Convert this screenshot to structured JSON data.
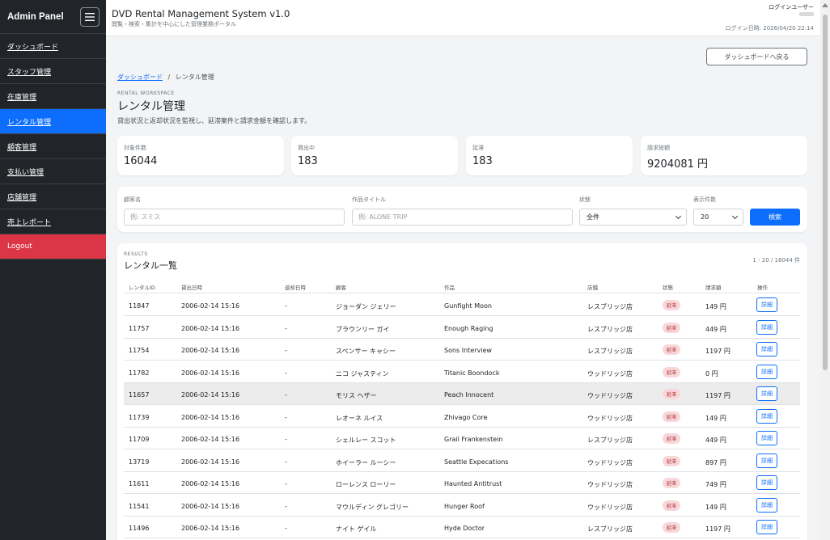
{
  "sidebar": {
    "title": "Admin Panel",
    "items": [
      {
        "label": "ダッシュボード"
      },
      {
        "label": "スタッフ管理"
      },
      {
        "label": "在庫管理"
      },
      {
        "label": "レンタル管理"
      },
      {
        "label": "顧客管理"
      },
      {
        "label": "支払い管理"
      },
      {
        "label": "店舗管理"
      },
      {
        "label": "売上レポート"
      }
    ],
    "logout": "Logout"
  },
  "header": {
    "title": "DVD Rental Management System v1.0",
    "subtitle": "閲覧・検索・集計を中心にした管理業務ポータル",
    "login_user_label": "ログインユーザー",
    "login_time": "ログイン日時: 2026/04/20 22:14"
  },
  "main": {
    "back_button": "ダッシュボードへ戻る",
    "breadcrumb": {
      "link": "ダッシュボード",
      "sep": "/",
      "current": "レンタル管理"
    },
    "eyebrow": "RENTAL WORKSPACE",
    "title": "レンタル管理",
    "description": "貸出状況と返却状況を監視し、延滞案件と請求金額を確認します。",
    "stats": [
      {
        "label": "対象件数",
        "value": "16044"
      },
      {
        "label": "貸出中",
        "value": "183"
      },
      {
        "label": "延滞",
        "value": "183"
      },
      {
        "label": "請求総額",
        "value": "9204081 円"
      }
    ],
    "filter": {
      "customer_label": "顧客名",
      "customer_placeholder": "例: スミス",
      "title_label": "作品タイトル",
      "title_placeholder": "例: ALONE TRIP",
      "status_label": "状態",
      "status_value": "全件",
      "count_label": "表示件数",
      "count_value": "20",
      "search_button": "検索"
    },
    "results": {
      "eyebrow": "RESULTS",
      "title": "レンタル一覧",
      "count": "1 - 20 / 16044 件",
      "columns": [
        "レンタルID",
        "貸出日時",
        "返却日時",
        "顧客",
        "作品",
        "店舗",
        "状態",
        "請求額",
        "操作"
      ],
      "rows": [
        {
          "id": "11847",
          "rented": "2006-02-14 15:16",
          "returned": "-",
          "customer": "ジョーダン ジェリー",
          "film": "Gunfight Moon",
          "store": "レスブリッジ店",
          "status": "延滞",
          "amount": "149 円",
          "action": "詳細"
        },
        {
          "id": "11757",
          "rented": "2006-02-14 15:16",
          "returned": "-",
          "customer": "ブラウンリー ガイ",
          "film": "Enough Raging",
          "store": "レスブリッジ店",
          "status": "延滞",
          "amount": "449 円",
          "action": "詳細"
        },
        {
          "id": "11754",
          "rented": "2006-02-14 15:16",
          "returned": "-",
          "customer": "スペンサー キャシー",
          "film": "Sons Interview",
          "store": "レスブリッジ店",
          "status": "延滞",
          "amount": "1197 円",
          "action": "詳細"
        },
        {
          "id": "11782",
          "rented": "2006-02-14 15:16",
          "returned": "-",
          "customer": "ニコ ジャスティン",
          "film": "Titanic Boondock",
          "store": "ウッドリッジ店",
          "status": "延滞",
          "amount": "0 円",
          "action": "詳細"
        },
        {
          "id": "11657",
          "rented": "2006-02-14 15:16",
          "returned": "-",
          "customer": "モリス ヘザー",
          "film": "Peach Innocent",
          "store": "ウッドリッジ店",
          "status": "延滞",
          "amount": "1197 円",
          "action": "詳細"
        },
        {
          "id": "11739",
          "rented": "2006-02-14 15:16",
          "returned": "-",
          "customer": "レオーネ ルイス",
          "film": "Zhivago Core",
          "store": "ウッドリッジ店",
          "status": "延滞",
          "amount": "149 円",
          "action": "詳細"
        },
        {
          "id": "11709",
          "rented": "2006-02-14 15:16",
          "returned": "-",
          "customer": "シェルレー スコット",
          "film": "Grail Frankenstein",
          "store": "レスブリッジ店",
          "status": "延滞",
          "amount": "449 円",
          "action": "詳細"
        },
        {
          "id": "13719",
          "rented": "2006-02-14 15:16",
          "returned": "-",
          "customer": "ホイーラー ルーシー",
          "film": "Seattle Expecations",
          "store": "ウッドリッジ店",
          "status": "延滞",
          "amount": "897 円",
          "action": "詳細"
        },
        {
          "id": "11611",
          "rented": "2006-02-14 15:16",
          "returned": "-",
          "customer": "ローレンス ローリー",
          "film": "Haunted Antitrust",
          "store": "ウッドリッジ店",
          "status": "延滞",
          "amount": "749 円",
          "action": "詳細"
        },
        {
          "id": "11541",
          "rented": "2006-02-14 15:16",
          "returned": "-",
          "customer": "マウルディン グレゴリー",
          "film": "Hunger Roof",
          "store": "ウッドリッジ店",
          "status": "延滞",
          "amount": "149 円",
          "action": "詳細"
        },
        {
          "id": "11496",
          "rented": "2006-02-14 15:16",
          "returned": "-",
          "customer": "ナイト ゲイル",
          "film": "Hyde Doctor",
          "store": "レスブリッジ店",
          "status": "延滞",
          "amount": "1197 円",
          "action": "詳細"
        }
      ],
      "highlighted_row": 4
    }
  },
  "colors": {
    "primary": "#0d6efd",
    "sidebar": "#212529",
    "danger": "#dc3545",
    "badge_bg": "#f8d7da",
    "badge_text": "#b02a37"
  },
  "icons": {
    "sidebar_toggle": "hamburger-icon",
    "select_arrow": "chevron-down-icon"
  }
}
